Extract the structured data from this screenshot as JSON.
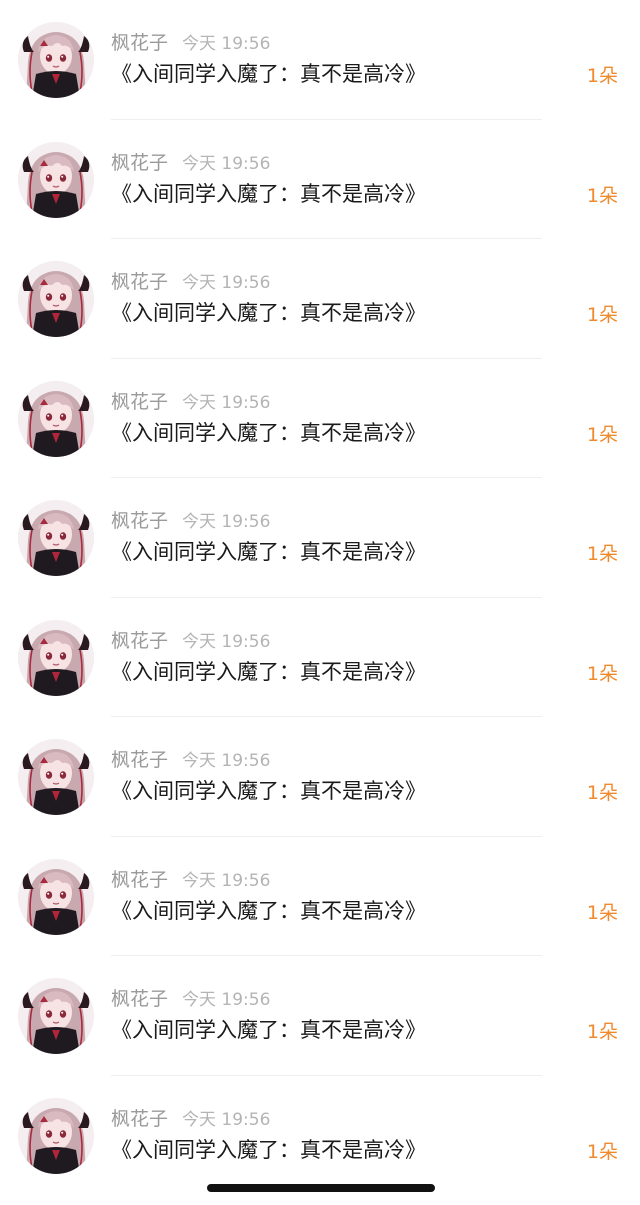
{
  "messages": [
    {
      "name": "枫花子",
      "time": "今天 19:56",
      "title": "《入间同学入魔了：真不是高冷》",
      "count": "1朵"
    },
    {
      "name": "枫花子",
      "time": "今天 19:56",
      "title": "《入间同学入魔了：真不是高冷》",
      "count": "1朵"
    },
    {
      "name": "枫花子",
      "time": "今天 19:56",
      "title": "《入间同学入魔了：真不是高冷》",
      "count": "1朵"
    },
    {
      "name": "枫花子",
      "time": "今天 19:56",
      "title": "《入间同学入魔了：真不是高冷》",
      "count": "1朵"
    },
    {
      "name": "枫花子",
      "time": "今天 19:56",
      "title": "《入间同学入魔了：真不是高冷》",
      "count": "1朵"
    },
    {
      "name": "枫花子",
      "time": "今天 19:56",
      "title": "《入间同学入魔了：真不是高冷》",
      "count": "1朵"
    },
    {
      "name": "枫花子",
      "time": "今天 19:56",
      "title": "《入间同学入魔了：真不是高冷》",
      "count": "1朵"
    },
    {
      "name": "枫花子",
      "time": "今天 19:56",
      "title": "《入间同学入魔了：真不是高冷》",
      "count": "1朵"
    },
    {
      "name": "枫花子",
      "time": "今天 19:56",
      "title": "《入间同学入魔了：真不是高冷》",
      "count": "1朵"
    },
    {
      "name": "枫花子",
      "time": "今天 19:56",
      "title": "《入间同学入魔了：真不是高冷》",
      "count": "1朵"
    }
  ],
  "colors": {
    "count_accent": "#f08a2e",
    "name_gray": "#9a9a9a",
    "time_gray": "#b4b4b4",
    "title_text": "#1a1a1a"
  },
  "icons": {
    "avatar": "anime-girl-avatar-icon"
  }
}
